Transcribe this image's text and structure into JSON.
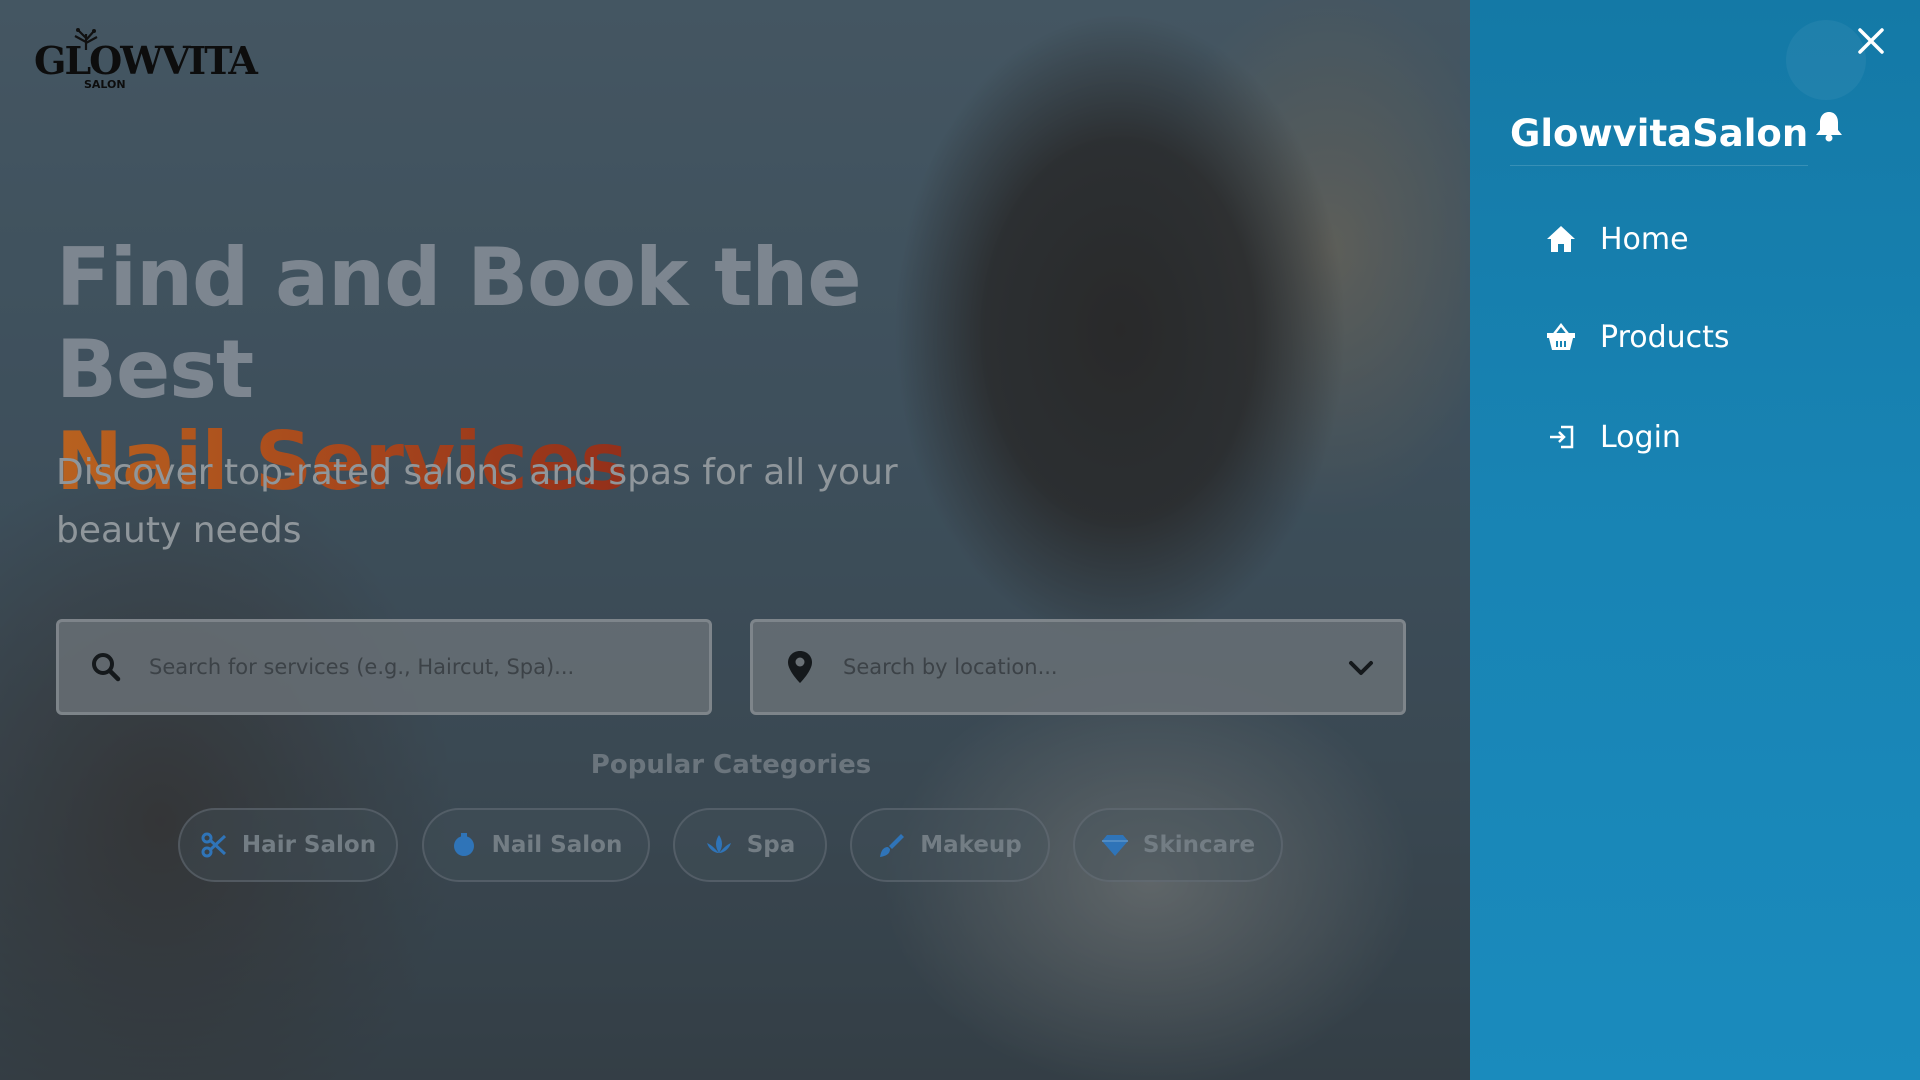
{
  "brand": {
    "logo_text": "GLOWVITA",
    "logo_subtext": "SALON"
  },
  "hero": {
    "headline_line1": "Find and Book the Best",
    "headline_line2": "Nail Services",
    "subtitle": "Discover top-rated salons and spas for all your beauty needs"
  },
  "search": {
    "services_placeholder": "Search for services (e.g., Haircut, Spa)...",
    "location_placeholder": "Search by location..."
  },
  "categories": {
    "title": "Popular Categories",
    "items": [
      {
        "label": "Hair Salon",
        "icon": "scissors-icon",
        "color": "#2f74b8"
      },
      {
        "label": "Nail Salon",
        "icon": "nail-polish-icon",
        "color": "#2f74b8"
      },
      {
        "label": "Spa",
        "icon": "lotus-icon",
        "color": "#2f74b8"
      },
      {
        "label": "Makeup",
        "icon": "makeup-brush-icon",
        "color": "#2f74b8"
      },
      {
        "label": "Skincare",
        "icon": "diamond-icon",
        "color": "#2f74b8"
      }
    ]
  },
  "sidebar": {
    "brand": "GlowvitaSalon",
    "background": "#1883b3",
    "items": [
      {
        "label": "Home",
        "icon": "home-icon"
      },
      {
        "label": "Products",
        "icon": "basket-icon"
      },
      {
        "label": "Login",
        "icon": "login-icon"
      }
    ]
  },
  "colors": {
    "accent_gradient_start": "#b8621f",
    "accent_gradient_end": "#8a2418"
  }
}
